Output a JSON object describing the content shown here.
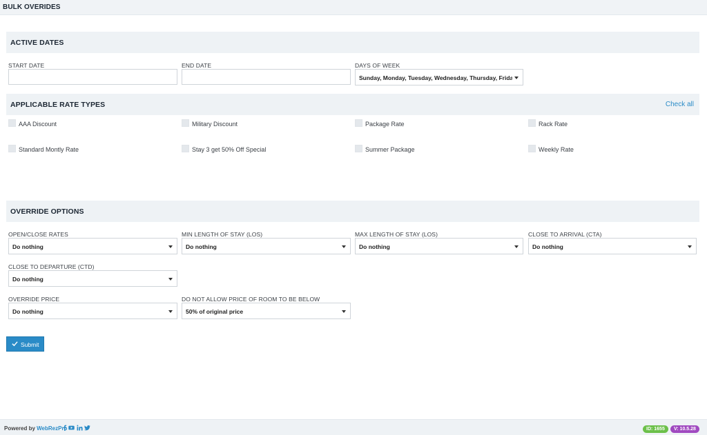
{
  "header": {
    "title": "BULK OVERIDES"
  },
  "active_dates": {
    "section_title": "ACTIVE DATES",
    "start_date": {
      "label": "START DATE",
      "value": ""
    },
    "end_date": {
      "label": "END DATE",
      "value": ""
    },
    "days_of_week": {
      "label": "DAYS OF WEEK",
      "value": "Sunday, Monday, Tuesday, Wednesday, Thursday, Friday, Saturday"
    }
  },
  "rate_types": {
    "section_title": "APPLICABLE RATE TYPES",
    "check_all": "Check all",
    "items": [
      {
        "label": "AAA Discount",
        "checked": false
      },
      {
        "label": "Military Discount",
        "checked": false
      },
      {
        "label": "Package Rate",
        "checked": false
      },
      {
        "label": "Rack Rate",
        "checked": false
      },
      {
        "label": "Standard Montly Rate",
        "checked": false
      },
      {
        "label": "Stay 3 get 50% Off Special",
        "checked": false
      },
      {
        "label": "Summer Package",
        "checked": false
      },
      {
        "label": "Weekly Rate",
        "checked": false
      }
    ]
  },
  "override_options": {
    "section_title": "OVERRIDE OPTIONS",
    "open_close": {
      "label": "OPEN/CLOSE RATES",
      "value": "Do nothing"
    },
    "min_los": {
      "label": "MIN LENGTH OF STAY (LOS)",
      "value": "Do nothing"
    },
    "max_los": {
      "label": "MAX LENGTH OF STAY (LOS)",
      "value": "Do nothing"
    },
    "cta": {
      "label": "CLOSE TO ARRIVAL (CTA)",
      "value": "Do nothing"
    },
    "ctd": {
      "label": "CLOSE TO DEPARTURE (CTD)",
      "value": "Do nothing"
    },
    "override_price": {
      "label": "OVERRIDE PRICE",
      "value": "Do nothing"
    },
    "min_price": {
      "label": "DO NOT ALLOW PRICE OF ROOM TO BE BELOW",
      "value": "50% of original price"
    }
  },
  "submit": {
    "label": "Submit"
  },
  "footer": {
    "powered_by": "Powered by",
    "brand": "WebRezPro",
    "social_icons": [
      "facebook-icon",
      "youtube-icon",
      "linkedin-icon",
      "twitter-icon"
    ],
    "id_badge": "ID: 1655",
    "version_badge": "V: 10.5.28"
  },
  "colors": {
    "accent": "#2a8bc7",
    "section_bg": "#eef2f5",
    "id_badge": "#6cc04a",
    "version_badge": "#a04ac0"
  }
}
